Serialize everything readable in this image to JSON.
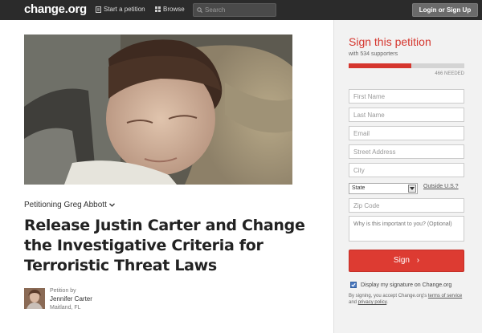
{
  "header": {
    "logo": "change.org",
    "start_petition": "Start a petition",
    "browse": "Browse",
    "search_placeholder": "Search",
    "login": "Login or Sign Up"
  },
  "petition": {
    "petitioning": "Petitioning Greg Abbott",
    "title": "Release Justin Carter and Change the Investigative Criteria for Terroristic Threat Laws",
    "creator_label": "Petition by",
    "creator_name": "Jennifer Carter",
    "creator_location": "Maitland, FL"
  },
  "sign": {
    "title": "Sign this petition",
    "supporters": "with 534 supporters",
    "progress_fraction": 0.54,
    "needed": "466 NEEDED",
    "fields": {
      "first_name": "First Name",
      "last_name": "Last Name",
      "email": "Email",
      "street": "Street Address",
      "city": "City",
      "state": "State",
      "zip": "Zip Code",
      "why": "Why is this important to you? (Optional)"
    },
    "outside_us": "Outside U.S.?",
    "button": "Sign",
    "display_signature": "Display my signature on Change.org",
    "terms_pre": "By signing, you accept Change.org's ",
    "terms_link": "terms of service",
    "terms_mid": " and ",
    "privacy_link": "privacy policy",
    "terms_post": "."
  },
  "colors": {
    "accent": "#d5362e",
    "topbar": "#2b2b2b"
  }
}
